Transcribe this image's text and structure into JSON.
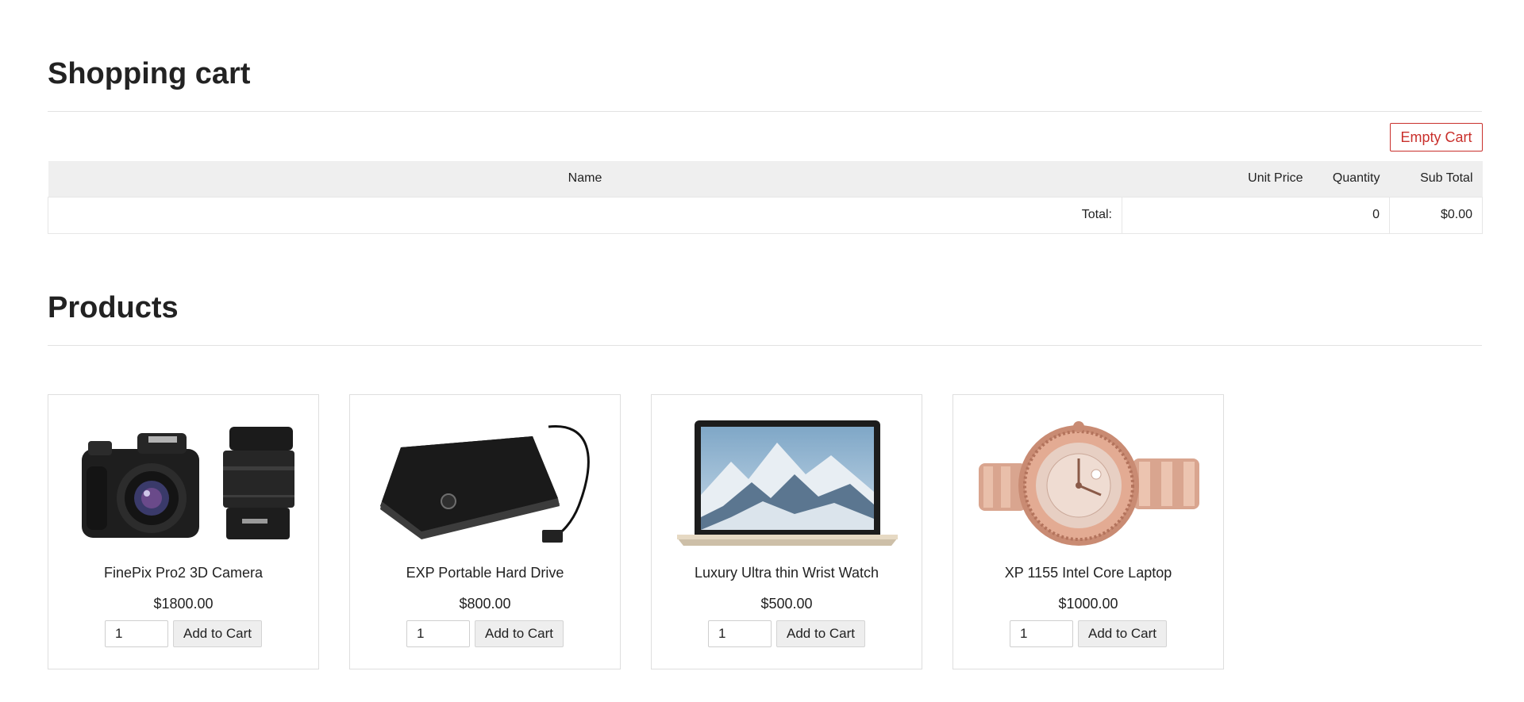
{
  "cart": {
    "title": "Shopping cart",
    "empty_button": "Empty Cart",
    "columns": {
      "name": "Name",
      "unit_price": "Unit Price",
      "quantity": "Quantity",
      "sub_total": "Sub Total"
    },
    "total_label": "Total:",
    "total_quantity": "0",
    "total_amount": "$0.00",
    "accent_color": "#c9302c"
  },
  "products": {
    "title": "Products",
    "add_label": "Add to Cart",
    "items": [
      {
        "name": "FinePix Pro2 3D Camera",
        "price": "$1800.00",
        "qty": "1",
        "image": "camera-image"
      },
      {
        "name": "EXP Portable Hard Drive",
        "price": "$800.00",
        "qty": "1",
        "image": "hard-drive-image"
      },
      {
        "name": "Luxury Ultra thin Wrist Watch",
        "price": "$500.00",
        "qty": "1",
        "image": "laptop-image"
      },
      {
        "name": "XP 1155 Intel Core Laptop",
        "price": "$1000.00",
        "qty": "1",
        "image": "wrist-watch-image"
      }
    ]
  }
}
